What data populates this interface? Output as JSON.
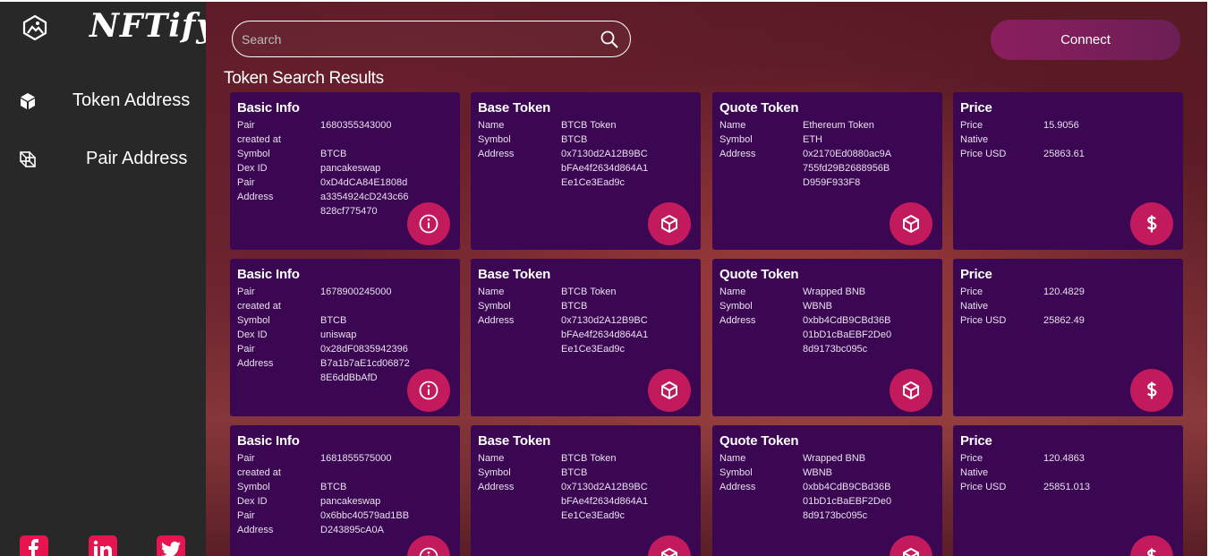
{
  "app": {
    "name": "NFTify"
  },
  "sidebar": {
    "items": [
      {
        "label": "Token Address",
        "icon": "cube-icon"
      },
      {
        "label": "Pair Address",
        "icon": "cubes-icon"
      }
    ],
    "social": [
      "facebook-icon",
      "linkedin-icon",
      "twitter-icon"
    ]
  },
  "search": {
    "placeholder": "Search",
    "value": ""
  },
  "connect_label": "Connect",
  "results_title": "Token Search Results",
  "results": [
    {
      "basic": {
        "title": "Basic Info",
        "rows": [
          {
            "k": "Pair created at",
            "v": "1680355343000"
          },
          {
            "k": "Symbol",
            "v": "BTCB"
          },
          {
            "k": "Dex ID",
            "v": "pancakeswap"
          },
          {
            "k": "Pair Address",
            "v": "0xD4dCA84E1808da3354924cD243c66828cf775470"
          }
        ]
      },
      "base": {
        "title": "Base Token",
        "rows": [
          {
            "k": "Name",
            "v": "BTCB Token"
          },
          {
            "k": "Symbol",
            "v": "BTCB"
          },
          {
            "k": "Address",
            "v": "0x7130d2A12B9BCbFAe4f2634d864A1Ee1Ce3Ead9c"
          }
        ]
      },
      "quote": {
        "title": "Quote Token",
        "rows": [
          {
            "k": "Name",
            "v": "Ethereum Token"
          },
          {
            "k": "Symbol",
            "v": "ETH"
          },
          {
            "k": "Address",
            "v": "0x2170Ed0880ac9A755fd29B2688956BD959F933F8"
          }
        ]
      },
      "price": {
        "title": "Price",
        "rows": [
          {
            "k": "Price Native",
            "v": "15.9056"
          },
          {
            "k": "Price USD",
            "v": "25863.61"
          }
        ]
      }
    },
    {
      "basic": {
        "title": "Basic Info",
        "rows": [
          {
            "k": "Pair created at",
            "v": "1678900245000"
          },
          {
            "k": "Symbol",
            "v": "BTCB"
          },
          {
            "k": "Dex ID",
            "v": "uniswap"
          },
          {
            "k": "Pair Address",
            "v": "0x28dF0835942396B7a1b7aE1cd068728E6ddBbAfD"
          }
        ]
      },
      "base": {
        "title": "Base Token",
        "rows": [
          {
            "k": "Name",
            "v": "BTCB Token"
          },
          {
            "k": "Symbol",
            "v": "BTCB"
          },
          {
            "k": "Address",
            "v": "0x7130d2A12B9BCbFAe4f2634d864A1Ee1Ce3Ead9c"
          }
        ]
      },
      "quote": {
        "title": "Quote Token",
        "rows": [
          {
            "k": "Name",
            "v": "Wrapped BNB"
          },
          {
            "k": "Symbol",
            "v": "WBNB"
          },
          {
            "k": "Address",
            "v": "0xbb4CdB9CBd36B01bD1cBaEBF2De08d9173bc095c"
          }
        ]
      },
      "price": {
        "title": "Price",
        "rows": [
          {
            "k": "Price Native",
            "v": "120.4829"
          },
          {
            "k": "Price USD",
            "v": "25862.49"
          }
        ]
      }
    },
    {
      "basic": {
        "title": "Basic Info",
        "rows": [
          {
            "k": "Pair created at",
            "v": "1681855575000"
          },
          {
            "k": "Symbol",
            "v": "BTCB"
          },
          {
            "k": "Dex ID",
            "v": "pancakeswap"
          },
          {
            "k": "Pair Address",
            "v": "0x6bbc40579ad1BBD243895cA0A"
          }
        ]
      },
      "base": {
        "title": "Base Token",
        "rows": [
          {
            "k": "Name",
            "v": "BTCB Token"
          },
          {
            "k": "Symbol",
            "v": "BTCB"
          },
          {
            "k": "Address",
            "v": "0x7130d2A12B9BCbFAe4f2634d864A1Ee1Ce3Ead9c"
          }
        ]
      },
      "quote": {
        "title": "Quote Token",
        "rows": [
          {
            "k": "Name",
            "v": "Wrapped BNB"
          },
          {
            "k": "Symbol",
            "v": "WBNB"
          },
          {
            "k": "Address",
            "v": "0xbb4CdB9CBd36B01bD1cBaEBF2De08d9173bc095c"
          }
        ]
      },
      "price": {
        "title": "Price",
        "rows": [
          {
            "k": "Price Native",
            "v": "120.4863"
          },
          {
            "k": "Price USD",
            "v": "25851.013"
          }
        ]
      }
    }
  ],
  "colors": {
    "card": "#3b0652",
    "accent": "#c21a5c",
    "sidebar": "#282828",
    "social": "#e8144f"
  }
}
